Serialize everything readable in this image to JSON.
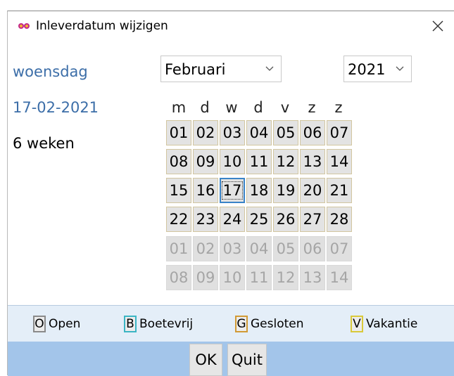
{
  "window": {
    "title": "Inleverdatum wijzigen",
    "icon": "glasses-icon"
  },
  "info": {
    "weekday": "woensdag",
    "date": "17-02-2021",
    "duration": "6 weken"
  },
  "month_select": {
    "value": "Februari"
  },
  "year_select": {
    "value": "2021"
  },
  "weekday_headers": [
    "m",
    "d",
    "w",
    "d",
    "v",
    "z",
    "z"
  ],
  "calendar": {
    "weeks": [
      [
        "01",
        "02",
        "03",
        "04",
        "05",
        "06",
        "07"
      ],
      [
        "08",
        "09",
        "10",
        "11",
        "12",
        "13",
        "14"
      ],
      [
        "15",
        "16",
        "17",
        "18",
        "19",
        "20",
        "21"
      ],
      [
        "22",
        "23",
        "24",
        "25",
        "26",
        "27",
        "28"
      ],
      [
        "01",
        "02",
        "03",
        "04",
        "05",
        "06",
        "07"
      ],
      [
        "08",
        "09",
        "10",
        "11",
        "12",
        "13",
        "14"
      ]
    ],
    "selected": "17"
  },
  "legend": {
    "open": {
      "key": "O",
      "label": "Open",
      "color": "#8a8a8a"
    },
    "boetevrij": {
      "key": "B",
      "label": "Boetevrij",
      "color": "#3bb5c4"
    },
    "gesloten": {
      "key": "G",
      "label": "Gesloten",
      "color": "#d19a35"
    },
    "vakantie": {
      "key": "V",
      "label": "Vakantie",
      "color": "#d9c93a"
    }
  },
  "buttons": {
    "ok": "OK",
    "quit": "Quit"
  },
  "colors": {
    "info_text": "#3c6ea8",
    "footer": "#a3c5ea",
    "legend_bg": "#e4eef8",
    "selected_border": "#3a84c8"
  }
}
